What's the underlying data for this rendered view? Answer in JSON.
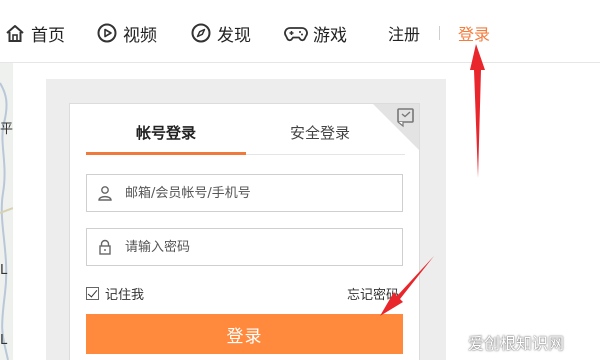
{
  "nav": {
    "home": "首页",
    "video": "视频",
    "discover": "发现",
    "games": "游戏",
    "register": "注册",
    "login": "登录"
  },
  "map": {
    "labels": [
      "平",
      "L",
      "L"
    ]
  },
  "login": {
    "tabs": [
      "帐号登录",
      "安全登录"
    ],
    "username_placeholder": "邮箱/会员帐号/手机号",
    "password_placeholder": "请输入密码",
    "remember_label": "记住我",
    "remember_checked": true,
    "forgot_label": "忘记密码",
    "submit_label": "登录"
  },
  "colors": {
    "accent": "#ff8a3d",
    "login_link": "#f47c3c",
    "annotation_arrow": "#e8262c"
  },
  "watermark": "爱创根知识网"
}
